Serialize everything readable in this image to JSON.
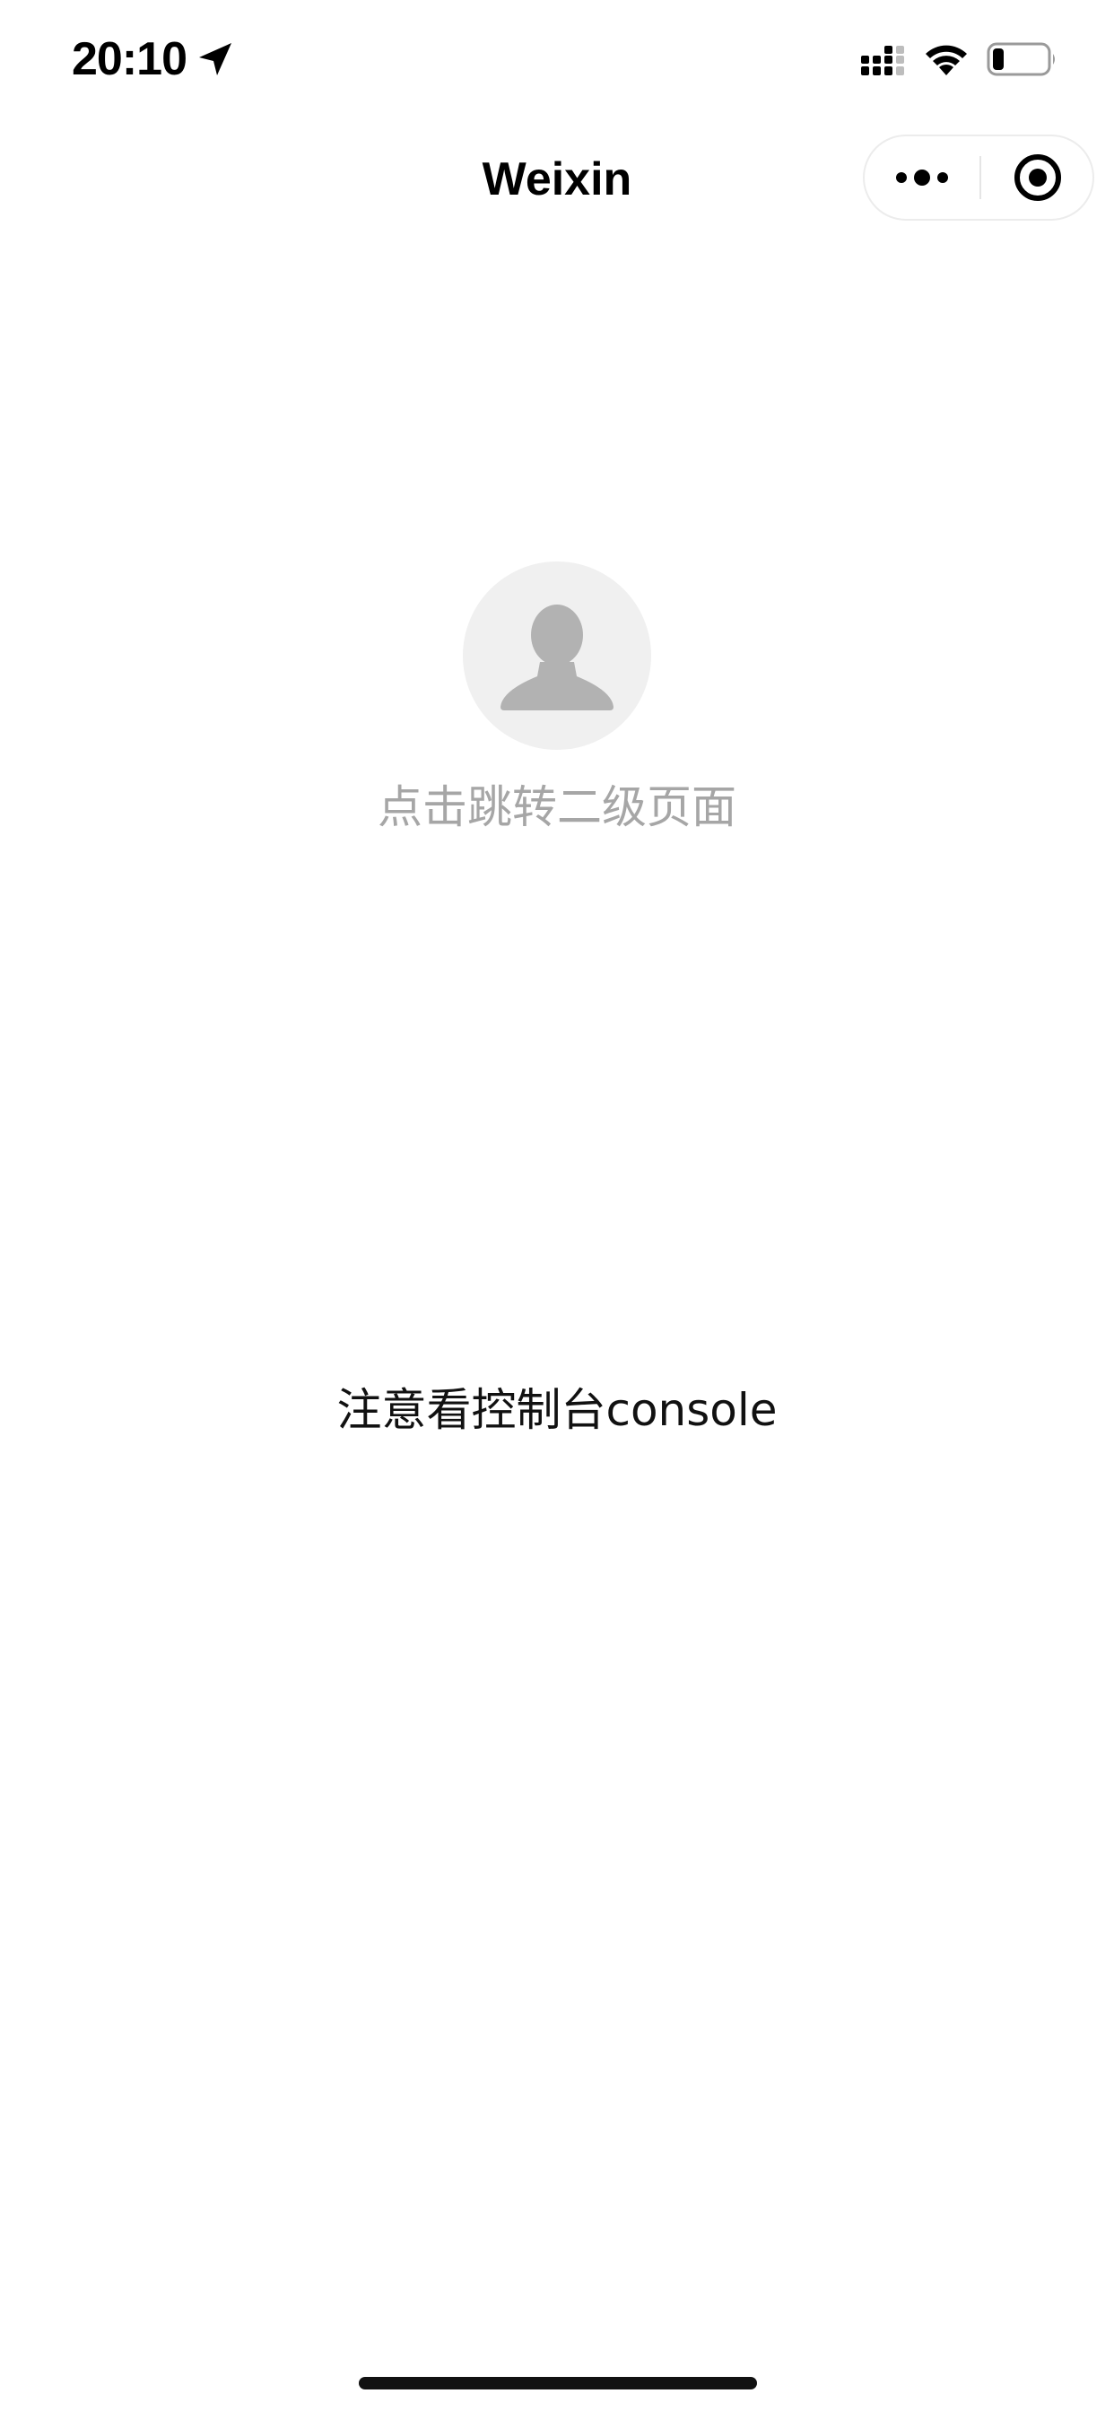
{
  "status_bar": {
    "time": "20:10",
    "icons": [
      "location-arrow-icon",
      "signal-icon",
      "wifi-icon",
      "battery-icon"
    ],
    "battery_level": 0.2
  },
  "nav": {
    "title": "Weixin",
    "more_icon": "more-dots-icon",
    "close_icon": "target-close-icon"
  },
  "main": {
    "avatar_icon": "person-silhouette-icon",
    "avatar_caption": "点击跳转二级页面",
    "console_hint": "注意看控制台console"
  },
  "colors": {
    "background": "#ffffff",
    "caption_gray": "#a6a6a6",
    "avatar_bg": "#f0f0f0",
    "avatar_fg": "#b2b2b2",
    "text": "#111111"
  }
}
